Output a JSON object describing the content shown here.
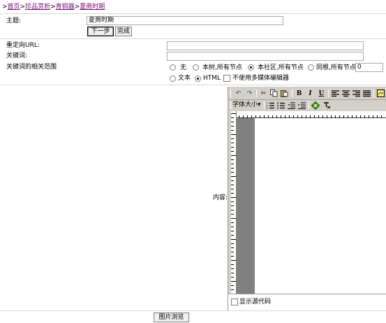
{
  "breadcrumb": {
    "prefix": ">",
    "items": [
      "首页",
      "珍品赏析",
      "青铜器",
      "夏商时期"
    ],
    "separator": ">"
  },
  "form": {
    "subject_label": "主题:",
    "subject_value": "夏商时期",
    "next_button": "下一步",
    "finish_button": "完成",
    "redirect_label": "重定向URL:",
    "redirect_value": "",
    "keywords_label": "关键词:",
    "keywords_value": "",
    "scope_label": "关键词的相关范围",
    "scope_options": [
      "无",
      "本树,所有节点",
      "本社区,所有节点",
      "同根,所有节点"
    ],
    "scope_selected": "本社区,所有节点",
    "scope_count": "0",
    "format_options": [
      "文本",
      "HTML"
    ],
    "format_selected": "HTML",
    "no_media_editor_label": "不使用多媒体编辑器",
    "content_label": "内容:",
    "font_size_label": "字体大小",
    "show_source_label": "显示源代码",
    "image_browse_button": "图片浏览"
  },
  "toolbar_icons": [
    "undo-icon",
    "redo-icon",
    "cut-icon",
    "copy-icon",
    "paste-icon",
    "bold-icon",
    "italic-icon",
    "underline-icon",
    "align-left-icon",
    "align-center-icon",
    "align-right-icon",
    "justify-icon",
    "image-icon",
    "ordered-list-icon",
    "unordered-list-icon",
    "outdent-icon",
    "indent-icon",
    "background-color-icon",
    "clear-format-icon"
  ],
  "colors": {
    "link": "#7a0a7a",
    "toolbar": "#d4d0c8"
  }
}
